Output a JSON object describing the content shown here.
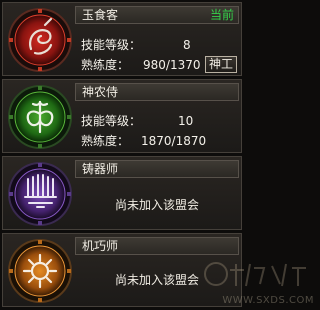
{
  "professions": [
    {
      "name": "玉食客",
      "status": "当前",
      "stats": [
        {
          "label": "技能等级：",
          "value": "8"
        },
        {
          "label": "熟练度：",
          "value": "980/1370"
        }
      ],
      "button_label": "神工",
      "emblem_icon": "swirl-emblem-icon",
      "emblem_color": "#c4201a"
    },
    {
      "name": "神农侍",
      "stats": [
        {
          "label": "技能等级：",
          "value": "10"
        },
        {
          "label": "熟练度：",
          "value": "1870/1870"
        }
      ],
      "emblem_icon": "leaf-emblem-icon",
      "emblem_color": "#3a9a2a"
    },
    {
      "name": "铸器师",
      "join_text": "尚未加入该盟会",
      "emblem_icon": "tools-emblem-icon",
      "emblem_color": "#6a3ea0"
    },
    {
      "name": "机巧师",
      "join_text": "尚未加入该盟会",
      "emblem_icon": "gear-emblem-icon",
      "emblem_color": "#d07a18"
    }
  ],
  "watermark": {
    "text": "WWW.SXDS.COM"
  }
}
